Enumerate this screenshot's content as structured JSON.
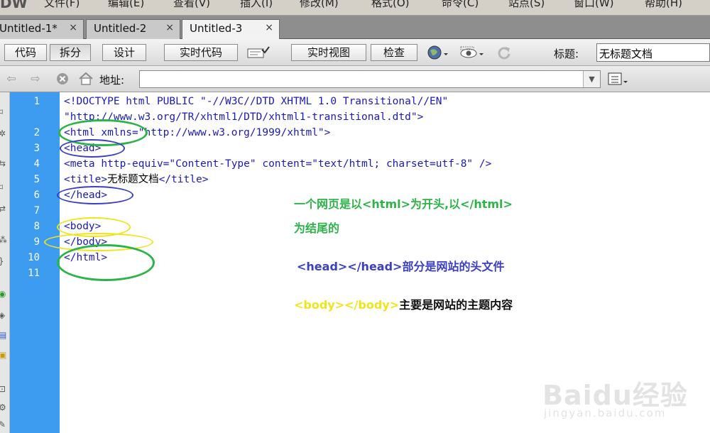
{
  "menu": {
    "logo": "DW",
    "items": [
      "文件(F)",
      "编辑(E)",
      "查看(V)",
      "插入(I)",
      "修改(M)",
      "格式(O)",
      "命令(C)",
      "站点(S)",
      "窗口(W)",
      "帮助(H)"
    ]
  },
  "tabs": [
    {
      "label": "Untitled-1*",
      "close": "×"
    },
    {
      "label": "Untitled-2",
      "close": "×"
    },
    {
      "label": "Untitled-3",
      "close": "×"
    }
  ],
  "toolbar": {
    "code": "代码",
    "split": "拆分",
    "design": "设计",
    "live_code": "实时代码",
    "live_view": "实时视图",
    "inspect": "检查",
    "title_label": "标题:",
    "title_value": "无标题文档"
  },
  "address": {
    "label": "地址:",
    "value": ""
  },
  "code": {
    "line_numbers": [
      "1",
      "2",
      "3",
      "4",
      "5",
      "6",
      "7",
      "8",
      "9",
      "10",
      "11"
    ],
    "lines": [
      "<!DOCTYPE html PUBLIC \"-//W3C//DTD XHTML 1.0 Transitional//EN\"",
      "\"http://www.w3.org/TR/xhtml1/DTD/xhtml1-transitional.dtd\">",
      "<html xmlns=\"http://www.w3.org/1999/xhtml\">",
      "<head>",
      "<meta http-equiv=\"Content-Type\" content=\"text/html; charset=utf-8\" />",
      "<title>",
      "无标题文档",
      "</title>",
      "</head>",
      "",
      "<body>",
      "</body>",
      "</html>",
      ""
    ]
  },
  "annotations": {
    "note1_line1": "一个网页是以<html>为开头,以</html>",
    "note1_line2": "为结尾的",
    "note2": "<head></head>部分是网站的头文件",
    "note3_tag": "<body></body>",
    "note3_text": "主要是网站的主题内容",
    "colors": {
      "green": "#2db34a",
      "blue": "#3b3fc2",
      "yellow": "#f0e41c"
    }
  },
  "watermark": {
    "brand": "Baidu经验",
    "url": "jingyan.baidu.com"
  }
}
